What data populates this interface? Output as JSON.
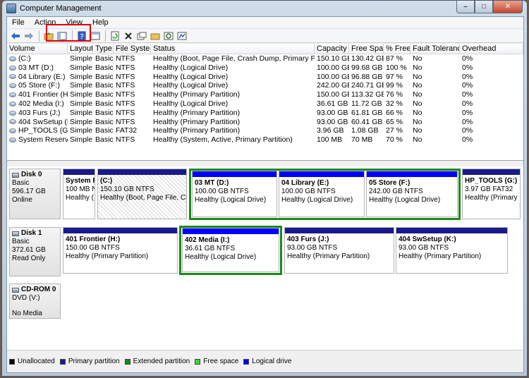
{
  "window": {
    "title": "Computer Management"
  },
  "menu": [
    "File",
    "Action",
    "View",
    "Help"
  ],
  "toolbar": {
    "icons": [
      "back-arrow-icon",
      "forward-arrow-icon",
      "up-folder-icon",
      "show-hide-tree-icon",
      "help-icon",
      "properties-pane-icon",
      "refresh-icon",
      "delete-icon",
      "properties-icon",
      "open-folder-icon",
      "search-icon",
      "explore-icon"
    ]
  },
  "volumes": {
    "columns": [
      "Volume",
      "Layout",
      "Type",
      "File System",
      "Status",
      "Capacity",
      "Free Space",
      "% Free",
      "Fault Tolerance",
      "Overhead"
    ],
    "rows": [
      [
        "(C:)",
        "Simple",
        "Basic",
        "NTFS",
        "Healthy (Boot, Page File, Crash Dump, Primary Partition)",
        "150.10 GB",
        "130.42 GB",
        "87 %",
        "No",
        "0%"
      ],
      [
        "03 MT (D:)",
        "Simple",
        "Basic",
        "NTFS",
        "Healthy (Logical Drive)",
        "100.00 GB",
        "99.68 GB",
        "100 %",
        "No",
        "0%"
      ],
      [
        "04 Library (E:)",
        "Simple",
        "Basic",
        "NTFS",
        "Healthy (Logical Drive)",
        "100.00 GB",
        "96.88 GB",
        "97 %",
        "No",
        "0%"
      ],
      [
        "05 Store (F:)",
        "Simple",
        "Basic",
        "NTFS",
        "Healthy (Logical Drive)",
        "242.00 GB",
        "240.71 GB",
        "99 %",
        "No",
        "0%"
      ],
      [
        "401 Frontier (H:)",
        "Simple",
        "Basic",
        "NTFS",
        "Healthy (Primary Partition)",
        "150.00 GB",
        "113.32 GB",
        "76 %",
        "No",
        "0%"
      ],
      [
        "402 Media (I:)",
        "Simple",
        "Basic",
        "NTFS",
        "Healthy (Logical Drive)",
        "36.61 GB",
        "11.72 GB",
        "32 %",
        "No",
        "0%"
      ],
      [
        "403 Furs (J:)",
        "Simple",
        "Basic",
        "NTFS",
        "Healthy (Primary Partition)",
        "93.00 GB",
        "61.81 GB",
        "66 %",
        "No",
        "0%"
      ],
      [
        "404 SwSetup (K:)",
        "Simple",
        "Basic",
        "NTFS",
        "Healthy (Primary Partition)",
        "93.00 GB",
        "60.41 GB",
        "65 %",
        "No",
        "0%"
      ],
      [
        "HP_TOOLS (G:)",
        "Simple",
        "Basic",
        "FAT32",
        "Healthy (Primary Partition)",
        "3.96 GB",
        "1.08 GB",
        "27 %",
        "No",
        "0%"
      ],
      [
        "System Reserved",
        "Simple",
        "Basic",
        "NTFS",
        "Healthy (System, Active, Primary Partition)",
        "100 MB",
        "70 MB",
        "70 %",
        "No",
        "0%"
      ]
    ]
  },
  "disks": [
    {
      "label": {
        "name": "Disk 0",
        "type": "Basic",
        "size": "596.17 GB",
        "status": "Online"
      },
      "partitions": [
        {
          "name": "System R",
          "size": "100 MB N",
          "status": "Healthy (",
          "bar": "primary"
        },
        {
          "name": "(C:)",
          "size": "150.10 GB NTFS",
          "status": "Healthy (Boot, Page File, Cras",
          "bar": "primary"
        },
        {
          "name": "03 MT  (D:)",
          "size": "100.00 GB NTFS",
          "status": "Healthy (Logical Drive)",
          "bar": "logical"
        },
        {
          "name": "04 Library  (E:)",
          "size": "100.00 GB NTFS",
          "status": "Healthy (Logical Drive)",
          "bar": "logical"
        },
        {
          "name": "05 Store  (F:)",
          "size": "242.00 GB NTFS",
          "status": "Healthy (Logical Drive)",
          "bar": "logical"
        },
        {
          "name": "HP_TOOLS  (G:)",
          "size": "3.97 GB FAT32",
          "status": "Healthy (Primary Par",
          "bar": "primary"
        }
      ]
    },
    {
      "label": {
        "name": "Disk 1",
        "type": "Basic",
        "size": "372.61 GB",
        "status": "Read Only"
      },
      "partitions": [
        {
          "name": "401 Frontier  (H:)",
          "size": "150.00 GB NTFS",
          "status": "Healthy (Primary Partition)",
          "bar": "primary"
        },
        {
          "name": "402 Media  (I:)",
          "size": "36.61 GB NTFS",
          "status": "Healthy (Logical Drive)",
          "bar": "logical"
        },
        {
          "name": "403 Furs  (J:)",
          "size": "93.00 GB NTFS",
          "status": "Healthy (Primary Partition)",
          "bar": "primary"
        },
        {
          "name": "404 SwSetup  (K:)",
          "size": "93.00 GB NTFS",
          "status": "Healthy (Primary Partition)",
          "bar": "primary"
        }
      ]
    },
    {
      "label": {
        "name": "CD-ROM 0",
        "type": "DVD (V:)",
        "size": "",
        "status": "No Media"
      }
    }
  ],
  "legend": [
    {
      "label": "Unallocated",
      "color": "#000000"
    },
    {
      "label": "Primary partition",
      "color": "#1a1a8a"
    },
    {
      "label": "Extended partition",
      "color": "#1a8a1a"
    },
    {
      "label": "Free space",
      "color": "#33dd33"
    },
    {
      "label": "Logical drive",
      "color": "#0000ff"
    }
  ]
}
